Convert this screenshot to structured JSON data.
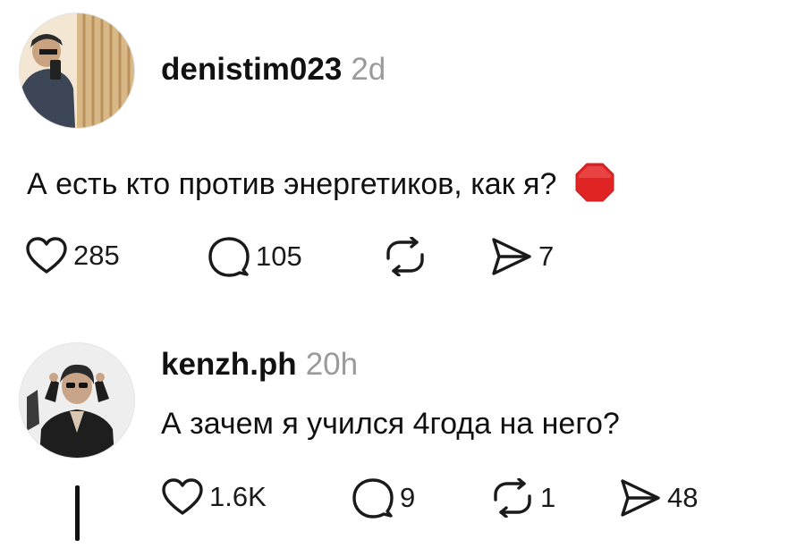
{
  "posts": [
    {
      "handle": "denistim023",
      "time": "2d",
      "text": "А есть кто против энергетиков, как я?",
      "emoji_icon": "stop-sign-icon",
      "actions": {
        "likes": "285",
        "comments": "105",
        "reposts": "",
        "shares": "7"
      }
    },
    {
      "handle": "kenzh.ph",
      "time": "20h",
      "text": "А зачем я учился 4года на него?",
      "actions": {
        "likes": "1.6K",
        "comments": "9",
        "reposts": "1",
        "shares": "48"
      }
    }
  ],
  "icons": {
    "like": "heart-icon",
    "comment": "speech-bubble-icon",
    "repost": "repost-arrows-icon",
    "share": "send-paper-plane-icon"
  },
  "colors": {
    "text": "#111111",
    "muted": "#9a9a9a",
    "stop_red": "#e02424"
  }
}
